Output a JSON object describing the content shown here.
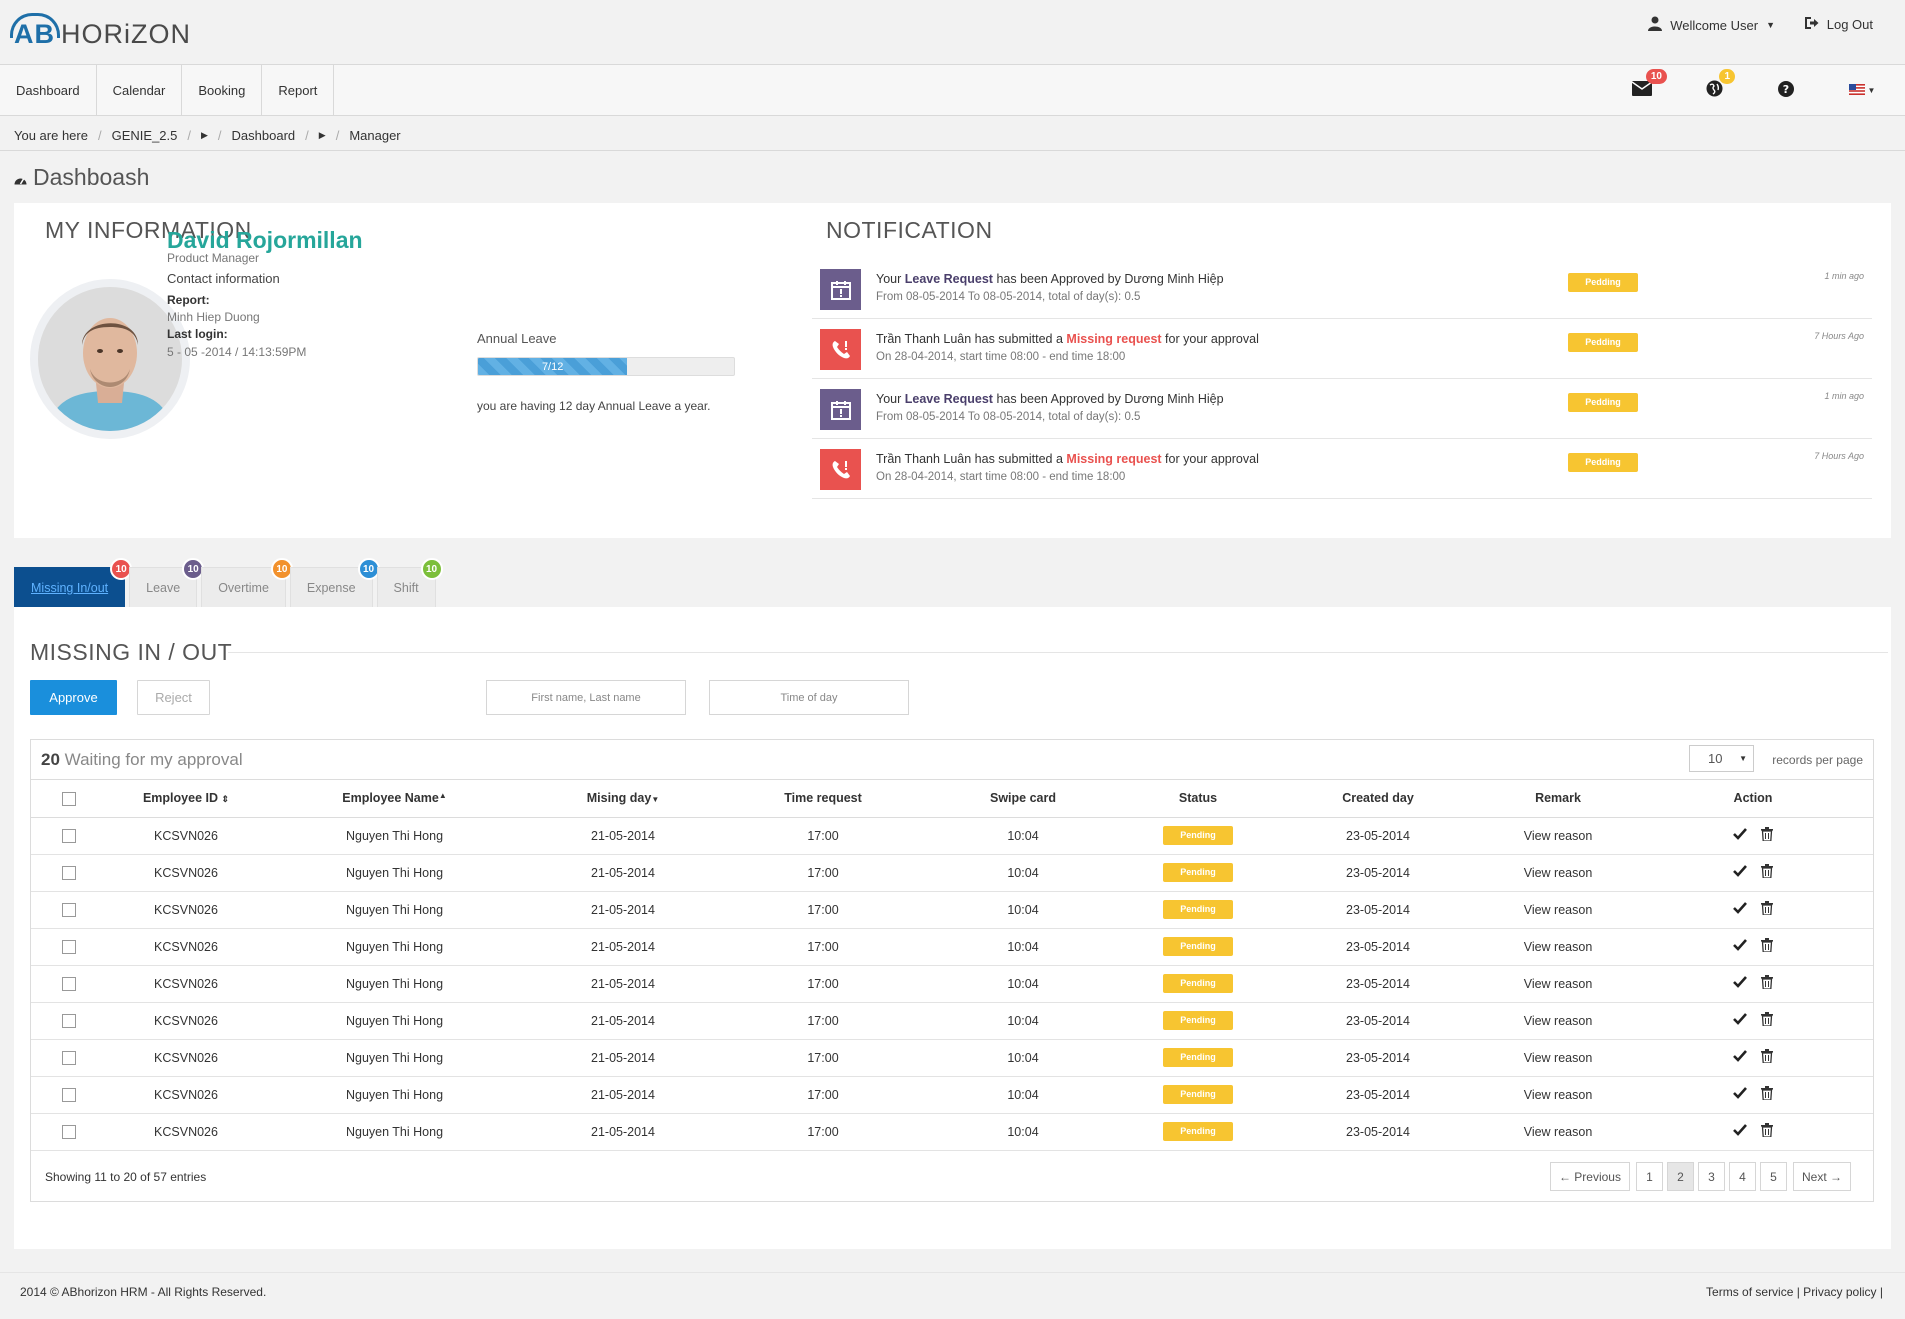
{
  "header": {
    "logo_ab": "AB",
    "logo_rest": "HORiZON",
    "welcome": "Wellcome User",
    "logout": "Log Out"
  },
  "nav": {
    "items": [
      "Dashboard",
      "Calendar",
      "Booking",
      "Report"
    ],
    "mail_count": "10",
    "globe_count": "1"
  },
  "breadcrumb": {
    "here": "You are here",
    "items": [
      "GENIE_2.5",
      "Dashboard",
      "Manager"
    ]
  },
  "page_title": "Dashboash",
  "my_info": {
    "title": "MY INFORMATION",
    "name": "David Rojormillan",
    "role": "Product Manager",
    "contact": "Contact information",
    "report_label": "Report:",
    "report_value": "Minh Hiep Duong",
    "login_label": "Last login:",
    "login_value": "5 - 05 -2014 / 14:13:59PM",
    "leave_label": "Annual Leave",
    "leave_progress": "7/12",
    "leave_fraction": 0.5833,
    "leave_note": "you are having 12 day Annual Leave a year."
  },
  "notification": {
    "title": "NOTIFICATION",
    "items": [
      {
        "icon": "calendar-icon",
        "color": "#6b5d8c",
        "pre": "Your ",
        "strong": "Leave Request",
        "post": " has been Approved by Dương Minh Hiệp",
        "sub": "From 08-05-2014 To 08-05-2014, total of day(s): 0.5",
        "tag": "Pedding",
        "time": "1 min ago"
      },
      {
        "icon": "phone-icon",
        "color": "#e9524f",
        "pre": "Trần Thanh Luân has submitted a ",
        "strong": "Missing request",
        "post": " for your approval",
        "sub": "On 28-04-2014, start time 08:00 - end time 18:00",
        "tag": "Pedding",
        "time": "7 Hours Ago"
      },
      {
        "icon": "calendar-icon",
        "color": "#6b5d8c",
        "pre": "Your ",
        "strong": "Leave Request",
        "post": " has been Approved by Dương Minh Hiệp",
        "sub": "From 08-05-2014 To 08-05-2014, total of day(s): 0.5",
        "tag": "Pedding",
        "time": "1 min ago"
      },
      {
        "icon": "phone-icon",
        "color": "#e9524f",
        "pre": "Trần Thanh Luân has submitted a ",
        "strong": "Missing request",
        "post": " for your approval",
        "sub": "On 28-04-2014, start time 08:00 - end time 18:00",
        "tag": "Pedding",
        "time": "7 Hours Ago"
      }
    ]
  },
  "tabs": [
    {
      "label": "Missing In/out",
      "count": "10",
      "color": "#e9524f"
    },
    {
      "label": "Leave",
      "count": "10",
      "color": "#6b5d8c"
    },
    {
      "label": "Overtime",
      "count": "10",
      "color": "#f2912c"
    },
    {
      "label": "Expense",
      "count": "10",
      "color": "#2d8fd6"
    },
    {
      "label": "Shift",
      "count": "10",
      "color": "#7cbf3a"
    }
  ],
  "missing": {
    "title": "MISSING IN / OUT",
    "approve": "Approve",
    "reject": "Reject",
    "name_placeholder": "First name, Last name",
    "time_placeholder": "Time of day",
    "waiting_count": "20",
    "waiting_text": "Waiting for my approval",
    "per_page_value": "10",
    "per_page_label": "records per page",
    "columns": [
      "Employee ID",
      "Employee Name",
      "Mising day",
      "Time request",
      "Swipe card",
      "Status",
      "Created day",
      "Remark",
      "Action"
    ],
    "rows": [
      {
        "id": "KCSVN026",
        "name": "Nguyen Thi Hong",
        "day": "21-05-2014",
        "time": "17:00",
        "swipe": "10:04",
        "status": "Pending",
        "created": "23-05-2014",
        "remark": "View reason"
      },
      {
        "id": "KCSVN026",
        "name": "Nguyen Thi Hong",
        "day": "21-05-2014",
        "time": "17:00",
        "swipe": "10:04",
        "status": "Pending",
        "created": "23-05-2014",
        "remark": "View reason"
      },
      {
        "id": "KCSVN026",
        "name": "Nguyen Thi Hong",
        "day": "21-05-2014",
        "time": "17:00",
        "swipe": "10:04",
        "status": "Pending",
        "created": "23-05-2014",
        "remark": "View reason"
      },
      {
        "id": "KCSVN026",
        "name": "Nguyen Thi Hong",
        "day": "21-05-2014",
        "time": "17:00",
        "swipe": "10:04",
        "status": "Pending",
        "created": "23-05-2014",
        "remark": "View reason"
      },
      {
        "id": "KCSVN026",
        "name": "Nguyen Thi Hong",
        "day": "21-05-2014",
        "time": "17:00",
        "swipe": "10:04",
        "status": "Pending",
        "created": "23-05-2014",
        "remark": "View reason"
      },
      {
        "id": "KCSVN026",
        "name": "Nguyen Thi Hong",
        "day": "21-05-2014",
        "time": "17:00",
        "swipe": "10:04",
        "status": "Pending",
        "created": "23-05-2014",
        "remark": "View reason"
      },
      {
        "id": "KCSVN026",
        "name": "Nguyen Thi Hong",
        "day": "21-05-2014",
        "time": "17:00",
        "swipe": "10:04",
        "status": "Pending",
        "created": "23-05-2014",
        "remark": "View reason"
      },
      {
        "id": "KCSVN026",
        "name": "Nguyen Thi Hong",
        "day": "21-05-2014",
        "time": "17:00",
        "swipe": "10:04",
        "status": "Pending",
        "created": "23-05-2014",
        "remark": "View reason"
      },
      {
        "id": "KCSVN026",
        "name": "Nguyen Thi Hong",
        "day": "21-05-2014",
        "time": "17:00",
        "swipe": "10:04",
        "status": "Pending",
        "created": "23-05-2014",
        "remark": "View reason"
      }
    ],
    "showing": "Showing 11 to 20 of 57 entries",
    "pager": [
      "← Previous",
      "1",
      "2",
      "3",
      "4",
      "5",
      "Next →"
    ],
    "pager_active": "2"
  },
  "footer": {
    "copyright": "2014 © ABhorizon HRM - All Rights Reserved.",
    "links": "Terms of service | Privacy policy |"
  },
  "colors": {
    "brand": "#1e6fa8",
    "primary_button": "#1a8fdc",
    "pending": "#f7c531",
    "name": "#26a69a",
    "tab_active": "#0c4f8f"
  }
}
